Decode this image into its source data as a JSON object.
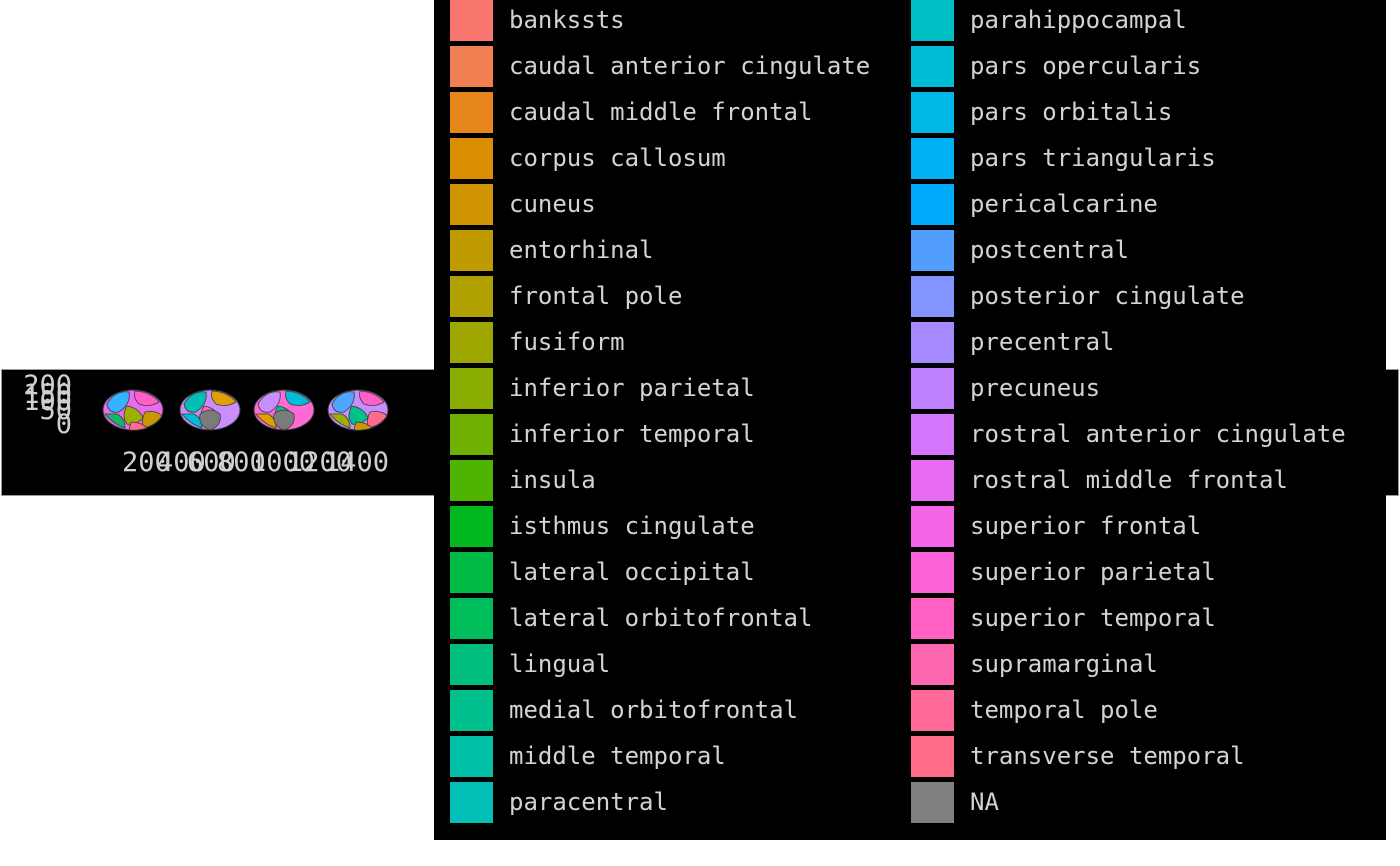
{
  "chart_data": {
    "type": "brain-atlas",
    "y_ticks": [
      "200",
      "150",
      "100",
      "50",
      "0"
    ],
    "x_ticks": [
      "200",
      "400",
      "600",
      "800",
      "1000",
      "1200",
      "1400"
    ],
    "brain_views": [
      {
        "name": "lateral-left",
        "colors": [
          "#e86bf0",
          "#35b3ff",
          "#ff5fc6",
          "#12b76a",
          "#9db000",
          "#c99700",
          "#ff6b8f"
        ]
      },
      {
        "name": "medial-left",
        "colors": [
          "#c88dff",
          "#00bfb0",
          "#e0a100",
          "#00bcd6",
          "#ff68c0",
          "#7b7b7b"
        ]
      },
      {
        "name": "medial-right",
        "colors": [
          "#ff6ad5",
          "#c88dff",
          "#00bcd6",
          "#e0a100",
          "#00c88b",
          "#7b7b7b"
        ]
      },
      {
        "name": "lateral-right",
        "colors": [
          "#c88dff",
          "#4da6ff",
          "#ff5fc6",
          "#9db000",
          "#00c08b",
          "#ff6b8f",
          "#c99700"
        ]
      }
    ],
    "legend": [
      {
        "label": "bankssts",
        "color": "#F8766D"
      },
      {
        "label": "caudal anterior cingulate",
        "color": "#F07F52"
      },
      {
        "label": "caudal middle frontal",
        "color": "#E7861B"
      },
      {
        "label": "corpus callosum",
        "color": "#DB8E00"
      },
      {
        "label": "cuneus",
        "color": "#CF9400"
      },
      {
        "label": "entorhinal",
        "color": "#C09B00"
      },
      {
        "label": "frontal pole",
        "color": "#B0A100"
      },
      {
        "label": "fusiform",
        "color": "#9EA700"
      },
      {
        "label": "inferior parietal",
        "color": "#89AC00"
      },
      {
        "label": "inferior temporal",
        "color": "#70B000"
      },
      {
        "label": "insula",
        "color": "#4FB400"
      },
      {
        "label": "isthmus cingulate",
        "color": "#00B81F"
      },
      {
        "label": "lateral occipital",
        "color": "#00BB45"
      },
      {
        "label": "lateral orbitofrontal",
        "color": "#00BD5C"
      },
      {
        "label": "lingual",
        "color": "#00BF7D"
      },
      {
        "label": "medial orbitofrontal",
        "color": "#00C08E"
      },
      {
        "label": "middle temporal",
        "color": "#00C1A7"
      },
      {
        "label": "paracentral",
        "color": "#00C0B8"
      },
      {
        "label": "parahippocampal",
        "color": "#00BFC4"
      },
      {
        "label": "pars opercularis",
        "color": "#00BDD6"
      },
      {
        "label": "pars orbitalis",
        "color": "#00B8E5"
      },
      {
        "label": "pars triangularis",
        "color": "#00B2F3"
      },
      {
        "label": "pericalcarine",
        "color": "#00ABFD"
      },
      {
        "label": "postcentral",
        "color": "#529EFF"
      },
      {
        "label": "posterior cingulate",
        "color": "#8494FF"
      },
      {
        "label": "precentral",
        "color": "#A58AFF"
      },
      {
        "label": "precuneus",
        "color": "#BF80FF"
      },
      {
        "label": "rostral anterior cingulate",
        "color": "#D575FE"
      },
      {
        "label": "rostral middle frontal",
        "color": "#E76BF3"
      },
      {
        "label": "superior frontal",
        "color": "#F365E6"
      },
      {
        "label": "superior parietal",
        "color": "#FC61D5"
      },
      {
        "label": "superior temporal",
        "color": "#FF62C3"
      },
      {
        "label": "supramarginal",
        "color": "#FF66B0"
      },
      {
        "label": "temporal pole",
        "color": "#FF6A98"
      },
      {
        "label": "transverse temporal",
        "color": "#FF6C85"
      },
      {
        "label": "NA",
        "color": "#808080"
      }
    ]
  }
}
